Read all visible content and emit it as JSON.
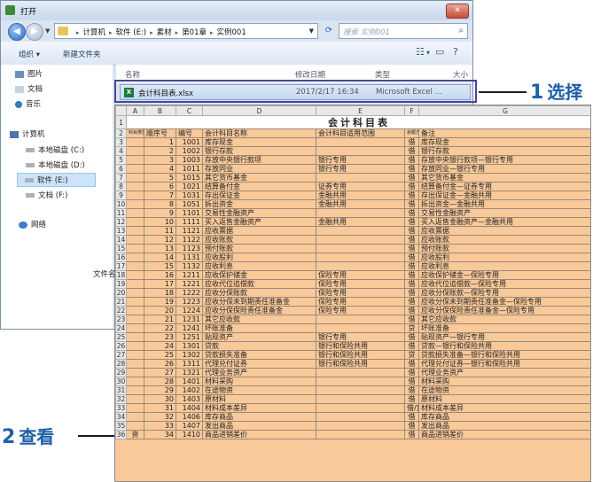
{
  "window": {
    "title": "打开",
    "close": "✕"
  },
  "address": {
    "crumbs": [
      "计算机",
      "软件 (E:)",
      "素材",
      "第01章",
      "实例001"
    ],
    "search_placeholder": "搜索 实例001"
  },
  "toolbar": {
    "organize": "组织 ▾",
    "new_folder": "新建文件夹"
  },
  "nav": {
    "items": [
      "图片",
      "文档",
      "音乐",
      "计算机",
      "本地磁盘 (C:)",
      "本地磁盘 (D:)",
      "软件 (E:)",
      "文档 (F:)",
      "网络"
    ]
  },
  "list": {
    "headers": {
      "name": "名称",
      "date": "修改日期",
      "type": "类型",
      "size": "大小"
    },
    "file": {
      "name": "会计科目表.xlsx",
      "date": "2017/2/17 16:34",
      "type": "Microsoft Excel ..."
    },
    "filename_label": "文件名"
  },
  "callouts": {
    "step1_num": "1",
    "step1_text": "选择",
    "step2_num": "2",
    "step2_text": "查看"
  },
  "sheet": {
    "col_headers": [
      "A",
      "B",
      "C",
      "D",
      "E",
      "F",
      "G"
    ],
    "title": "会计科目表",
    "header_row": [
      "科目类型",
      "顺序号",
      "编号",
      "会计科目名称",
      "会计科目适用范围",
      "余额方向",
      "备注"
    ],
    "rows": [
      [
        "",
        "1",
        "1001",
        "库存现金",
        "",
        "借",
        "库存现金"
      ],
      [
        "",
        "2",
        "1002",
        "银行存款",
        "",
        "借",
        "银行存款"
      ],
      [
        "",
        "3",
        "1003",
        "存放中央银行款项",
        "银行专用",
        "借",
        "存放中央银行款项—银行专用"
      ],
      [
        "",
        "4",
        "1011",
        "存放同业",
        "银行专用",
        "借",
        "存放同业—银行专用"
      ],
      [
        "",
        "5",
        "1015",
        "其它货币基金",
        "",
        "借",
        "其它货币基金"
      ],
      [
        "",
        "6",
        "1021",
        "结算备付金",
        "证券专用",
        "借",
        "结算备付金—证券专用"
      ],
      [
        "",
        "7",
        "1031",
        "存出保证金",
        "金融共用",
        "借",
        "存出保证金—金融共用"
      ],
      [
        "",
        "8",
        "1051",
        "拆出资金",
        "金融共用",
        "借",
        "拆出资金—金融共用"
      ],
      [
        "",
        "9",
        "1101",
        "交易性金融资产",
        "",
        "借",
        "交易性金融资产"
      ],
      [
        "",
        "10",
        "1111",
        "买入返售金融资产",
        "金融共用",
        "借",
        "买入返售金融资产—金融共用"
      ],
      [
        "",
        "11",
        "1121",
        "应收票据",
        "",
        "借",
        "应收票据"
      ],
      [
        "",
        "12",
        "1122",
        "应收账款",
        "",
        "借",
        "应收账款"
      ],
      [
        "",
        "13",
        "1123",
        "预付账款",
        "",
        "借",
        "预付账款"
      ],
      [
        "",
        "14",
        "1131",
        "应收股利",
        "",
        "借",
        "应收股利"
      ],
      [
        "",
        "15",
        "1132",
        "应收利息",
        "",
        "借",
        "应收利息"
      ],
      [
        "",
        "16",
        "1211",
        "应收保护储金",
        "保险专用",
        "借",
        "应收保护储金—保险专用"
      ],
      [
        "",
        "17",
        "1221",
        "应收代位追偿款",
        "保险专用",
        "借",
        "应收代位追偿款—保险专用"
      ],
      [
        "",
        "18",
        "1222",
        "应收分保账款",
        "保险专用",
        "借",
        "应收分保账款—保险专用"
      ],
      [
        "",
        "19",
        "1223",
        "应收分保未到期责任准备金",
        "保险专用",
        "借",
        "应收分保未到期责任准备金—保险专用"
      ],
      [
        "",
        "20",
        "1224",
        "应收分保保险责任准备金",
        "保险专用",
        "借",
        "应收分保保险责任准备金—保险专用"
      ],
      [
        "",
        "21",
        "1231",
        "其它应收款",
        "",
        "借",
        "其它应收款"
      ],
      [
        "",
        "22",
        "1241",
        "坏账准备",
        "",
        "贷",
        "坏账准备"
      ],
      [
        "",
        "23",
        "1251",
        "贴现资产",
        "银行专用",
        "借",
        "贴现资产—银行专用"
      ],
      [
        "",
        "24",
        "1301",
        "贷款",
        "银行和保险共用",
        "借",
        "贷款—银行和保险共用"
      ],
      [
        "",
        "25",
        "1302",
        "贷款损失准备",
        "银行和保险共用",
        "贷",
        "贷款损失准备—银行和保险共用"
      ],
      [
        "",
        "26",
        "1311",
        "代理兑付证券",
        "银行和保险共用",
        "借",
        "代理兑付证券—银行和保险共用"
      ],
      [
        "",
        "27",
        "1321",
        "代理业务资产",
        "",
        "借",
        "代理业务资产"
      ],
      [
        "",
        "28",
        "1401",
        "材料采购",
        "",
        "借",
        "材料采购"
      ],
      [
        "",
        "29",
        "1402",
        "在途物资",
        "",
        "借",
        "在途物资"
      ],
      [
        "",
        "30",
        "1403",
        "原材料",
        "",
        "借",
        "原材料"
      ],
      [
        "",
        "31",
        "1404",
        "材料成本差异",
        "",
        "借/贷",
        "材料成本差异"
      ],
      [
        "",
        "32",
        "1406",
        "库存商品",
        "",
        "借",
        "库存商品"
      ],
      [
        "",
        "33",
        "1407",
        "发出商品",
        "",
        "借",
        "发出商品"
      ],
      [
        "资",
        "34",
        "1410",
        "商品进销差价",
        "",
        "借",
        "商品进销差价"
      ]
    ]
  }
}
